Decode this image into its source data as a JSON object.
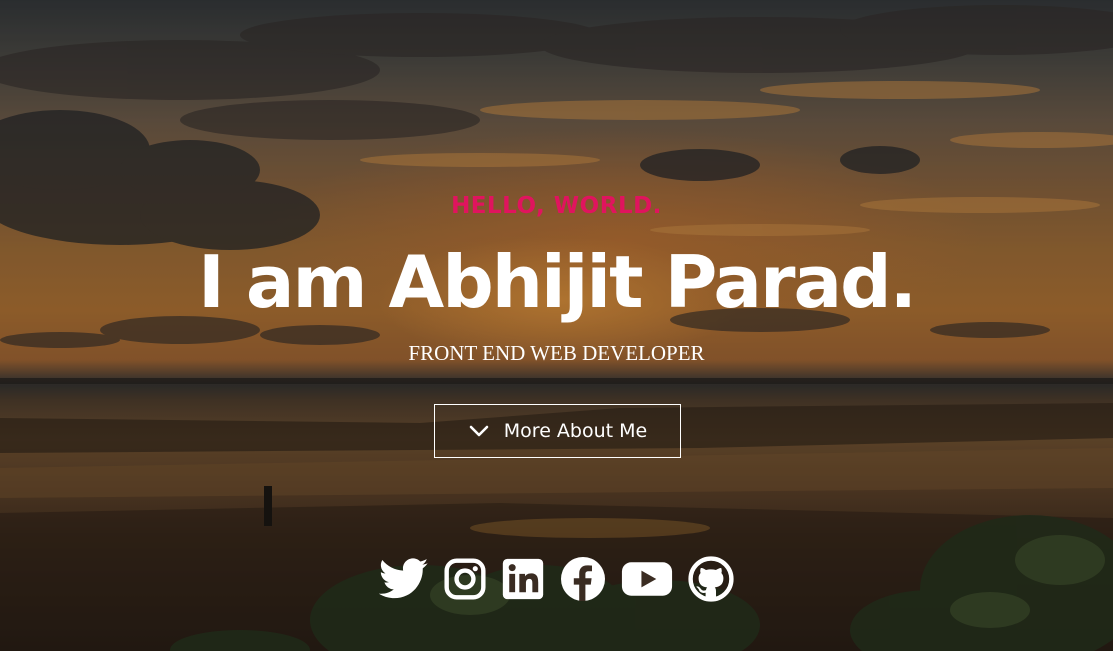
{
  "hero": {
    "greeting": "HELLO, WORLD.",
    "name": "I am Abhijit Parad.",
    "role": "FRONT END WEB DEVELOPER",
    "more_button_label": "More About Me"
  },
  "socials": [
    {
      "icon": "twitter-icon"
    },
    {
      "icon": "instagram-icon"
    },
    {
      "icon": "linkedin-icon"
    },
    {
      "icon": "facebook-icon"
    },
    {
      "icon": "youtube-icon"
    },
    {
      "icon": "github-icon"
    }
  ],
  "colors": {
    "accent": "#e0145e",
    "text": "#ffffff"
  }
}
